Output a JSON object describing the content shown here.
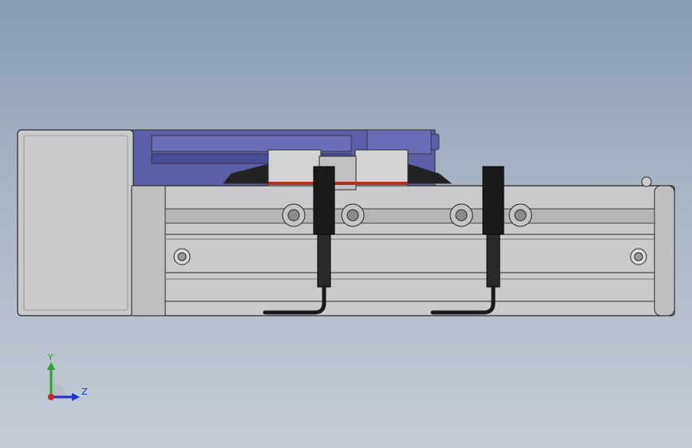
{
  "viewport": {
    "background_top": "#8a9bb0",
    "background_bottom": "#c3ccd6"
  },
  "model": {
    "parts": [
      "motor-housing",
      "linear-actuator-body",
      "gripper-carriage",
      "gripper-jaws",
      "proximity-sensors",
      "sensor-cables",
      "mounting-screws",
      "carriage-bolts"
    ],
    "colors": {
      "body": "#c9cacc",
      "body_dark": "#9a9b9d",
      "carriage": "#5b5fa8",
      "carriage_dark": "#3b3f80",
      "sensor": "#1a1a1a",
      "outline": "#2a2a2a",
      "seal": "#b03020"
    }
  },
  "triad": {
    "y_label": "Y",
    "z_label": "Z",
    "y_color": "#22aa22",
    "z_color": "#2233cc",
    "x_color": "#cc2222"
  }
}
